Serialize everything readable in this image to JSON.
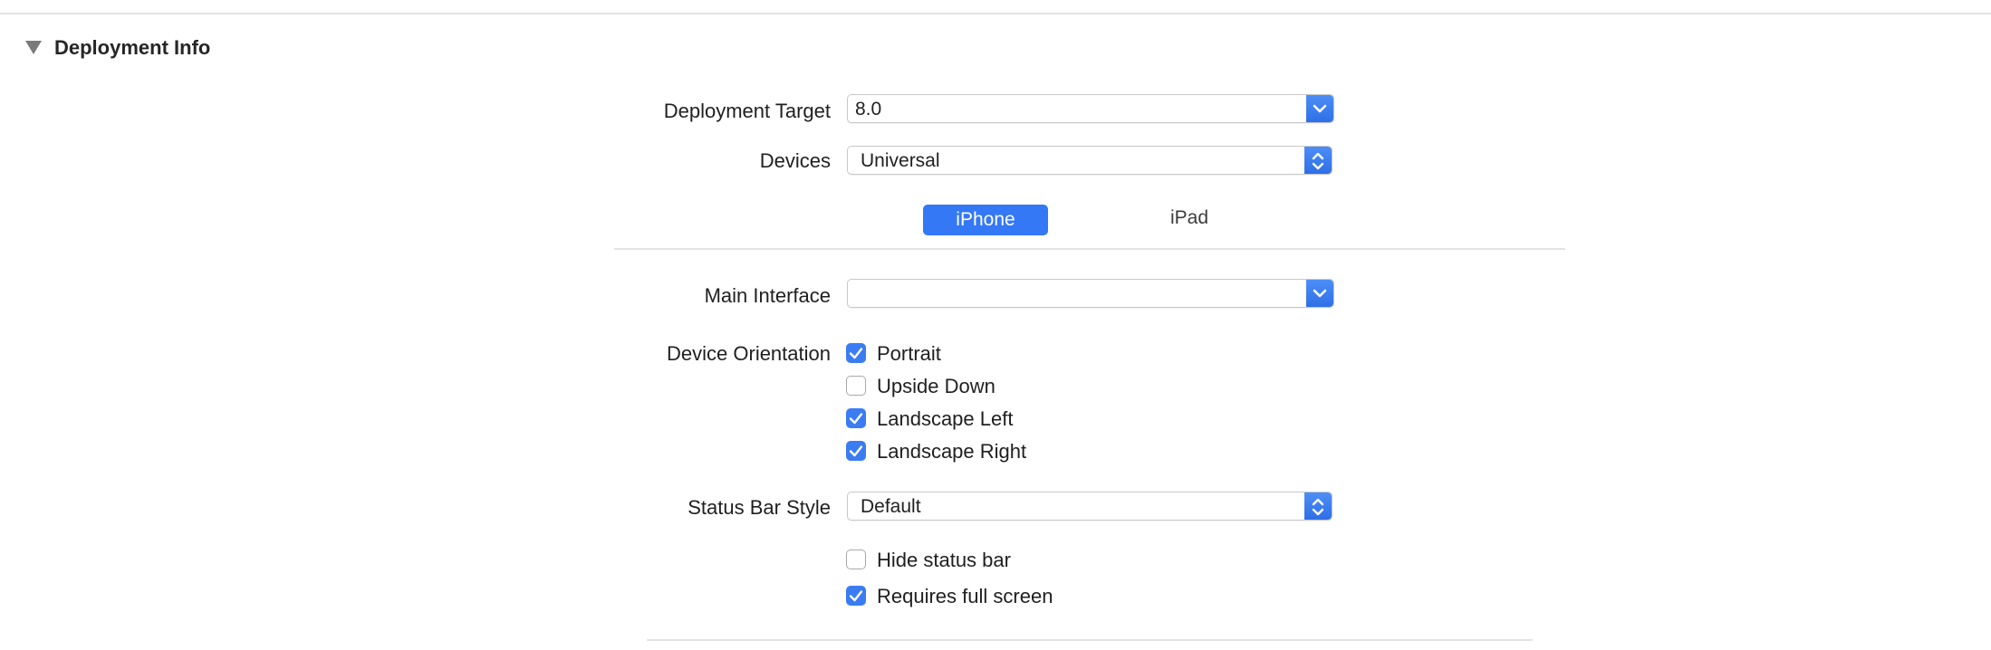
{
  "section": {
    "title": "Deployment Info"
  },
  "deployment_target": {
    "label": "Deployment Target",
    "value": "8.0"
  },
  "devices": {
    "label": "Devices",
    "value": "Universal"
  },
  "device_tabs": [
    "iPhone",
    "iPad"
  ],
  "main_interface": {
    "label": "Main Interface",
    "value": ""
  },
  "device_orientation": {
    "label": "Device Orientation",
    "options": [
      {
        "label": "Portrait",
        "checked": true
      },
      {
        "label": "Upside Down",
        "checked": false
      },
      {
        "label": "Landscape Left",
        "checked": true
      },
      {
        "label": "Landscape Right",
        "checked": true
      }
    ]
  },
  "status_bar_style": {
    "label": "Status Bar Style",
    "value": "Default"
  },
  "status_options": [
    {
      "label": "Hide status bar",
      "checked": false
    },
    {
      "label": "Requires full screen",
      "checked": true
    }
  ],
  "colors": {
    "accent": "#3478f6"
  }
}
